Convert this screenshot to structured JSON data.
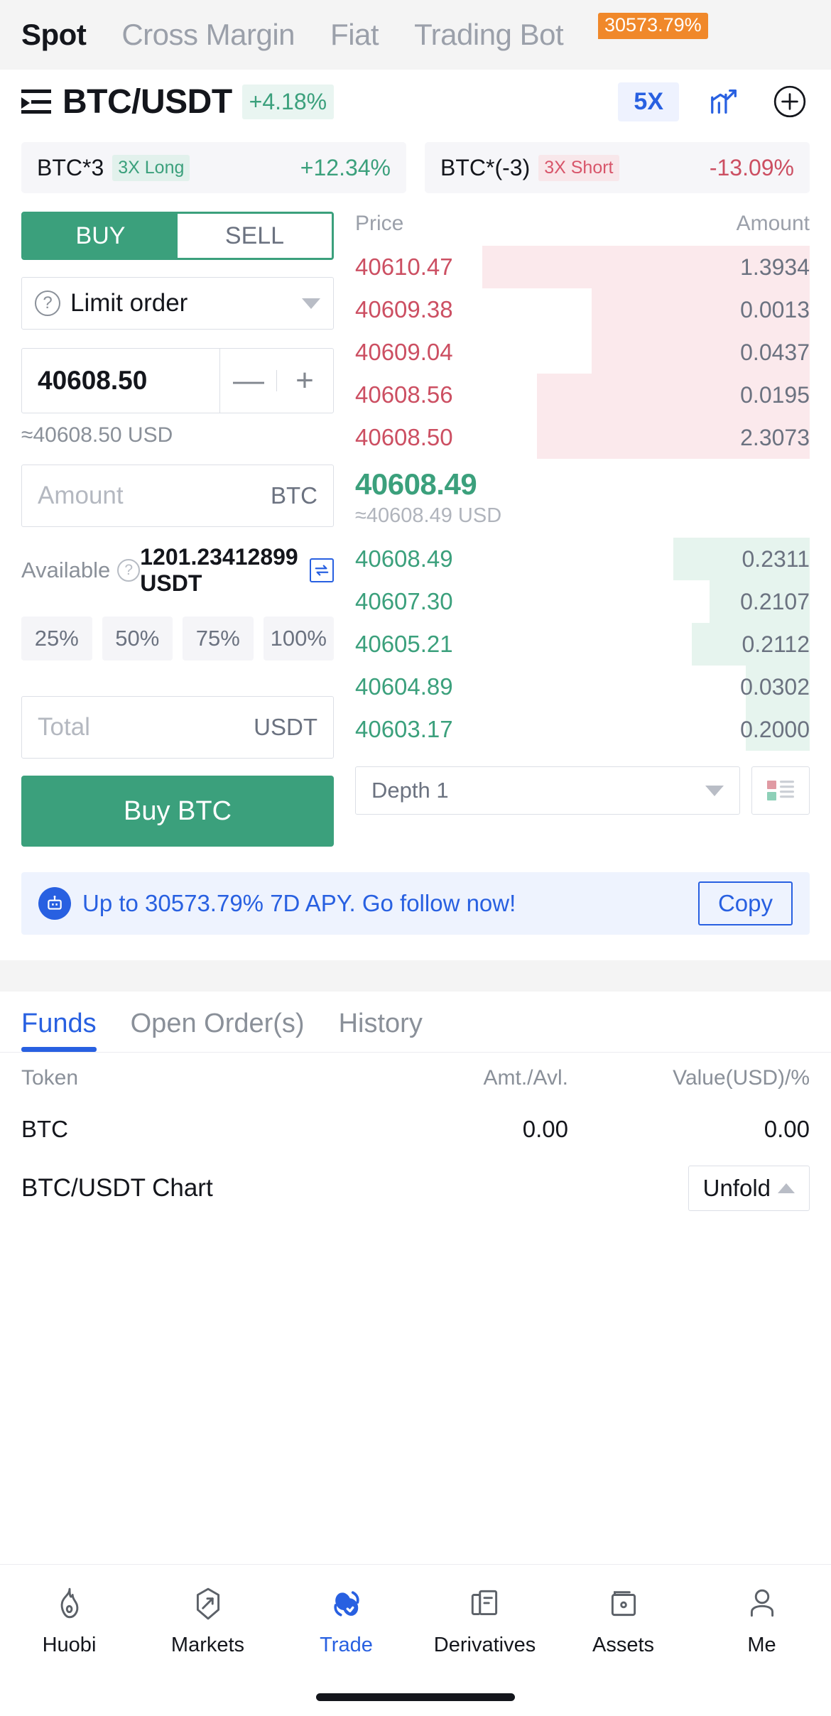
{
  "top_tabs": [
    {
      "label": "Spot",
      "active": true
    },
    {
      "label": "Cross Margin",
      "active": false
    },
    {
      "label": "Fiat",
      "active": false
    },
    {
      "label": "Trading Bot",
      "active": false
    }
  ],
  "promo_badge": "30573.79%",
  "pair": {
    "name": "BTC/USDT",
    "change": "+4.18%",
    "leverage": "5X",
    "list_icon": "pair-list-icon",
    "chart_icon": "chart-icon",
    "add_icon": "plus-circle-icon"
  },
  "leveraged_tokens": [
    {
      "symbol": "BTC*3",
      "tag": "3X Long",
      "change": "+12.34%",
      "direction": "up"
    },
    {
      "symbol": "BTC*(-3)",
      "tag": "3X Short",
      "change": "-13.09%",
      "direction": "down"
    }
  ],
  "order_form": {
    "buy_label": "BUY",
    "sell_label": "SELL",
    "active_side": "BUY",
    "order_type": "Limit order",
    "price_value": "40608.50",
    "price_minus": "—",
    "price_plus": "+",
    "price_conversion": "≈40608.50 USD",
    "amount_placeholder": "Amount",
    "amount_unit": "BTC",
    "available_label": "Available",
    "available_value": "1201.23412899 USDT",
    "percent_options": [
      "25%",
      "50%",
      "75%",
      "100%"
    ],
    "total_placeholder": "Total",
    "total_unit": "USDT",
    "submit_label": "Buy  BTC"
  },
  "order_book": {
    "col_price": "Price",
    "col_amount": "Amount",
    "asks": [
      {
        "price": "40610.47",
        "amount": "1.3934",
        "depth": 72
      },
      {
        "price": "40609.38",
        "amount": "0.0013",
        "depth": 48
      },
      {
        "price": "40609.04",
        "amount": "0.0437",
        "depth": 48
      },
      {
        "price": "40608.56",
        "amount": "0.0195",
        "depth": 60
      },
      {
        "price": "40608.50",
        "amount": "2.3073",
        "depth": 60
      }
    ],
    "mid_price": "40608.49",
    "mid_price_usd": "≈40608.49 USD",
    "bids": [
      {
        "price": "40608.49",
        "amount": "0.2311",
        "depth": 30
      },
      {
        "price": "40607.30",
        "amount": "0.2107",
        "depth": 22
      },
      {
        "price": "40605.21",
        "amount": "0.2112",
        "depth": 26
      },
      {
        "price": "40604.89",
        "amount": "0.0302",
        "depth": 14
      },
      {
        "price": "40603.17",
        "amount": "0.2000",
        "depth": 14
      }
    ],
    "depth_label": "Depth 1",
    "layout_icon": "order-book-layout-icon"
  },
  "promo_banner": {
    "icon": "robot-icon",
    "text": "Up to 30573.79% 7D APY. Go follow now!",
    "copy_label": "Copy"
  },
  "funds": {
    "tabs": [
      {
        "label": "Funds",
        "active": true
      },
      {
        "label": "Open Order(s)",
        "active": false
      },
      {
        "label": "History",
        "active": false
      }
    ],
    "columns": [
      "Token",
      "Amt./Avl.",
      "Value(USD)/%"
    ],
    "rows": [
      {
        "token": "BTC",
        "amount": "0.00",
        "value": "0.00"
      }
    ],
    "chart_label": "BTC/USDT Chart",
    "unfold_label": "Unfold"
  },
  "bottom_nav": [
    {
      "label": "Huobi",
      "icon": "flame-icon",
      "active": false
    },
    {
      "label": "Markets",
      "icon": "markets-shield-icon",
      "active": false
    },
    {
      "label": "Trade",
      "icon": "trade-swap-icon",
      "active": true
    },
    {
      "label": "Derivatives",
      "icon": "derivatives-doc-icon",
      "active": false
    },
    {
      "label": "Assets",
      "icon": "assets-wallet-icon",
      "active": false
    },
    {
      "label": "Me",
      "icon": "user-icon",
      "active": false
    }
  ],
  "colors": {
    "green": "#3ba07c",
    "red": "#cc4f62",
    "blue": "#2860e1",
    "orange": "#f0882a"
  }
}
